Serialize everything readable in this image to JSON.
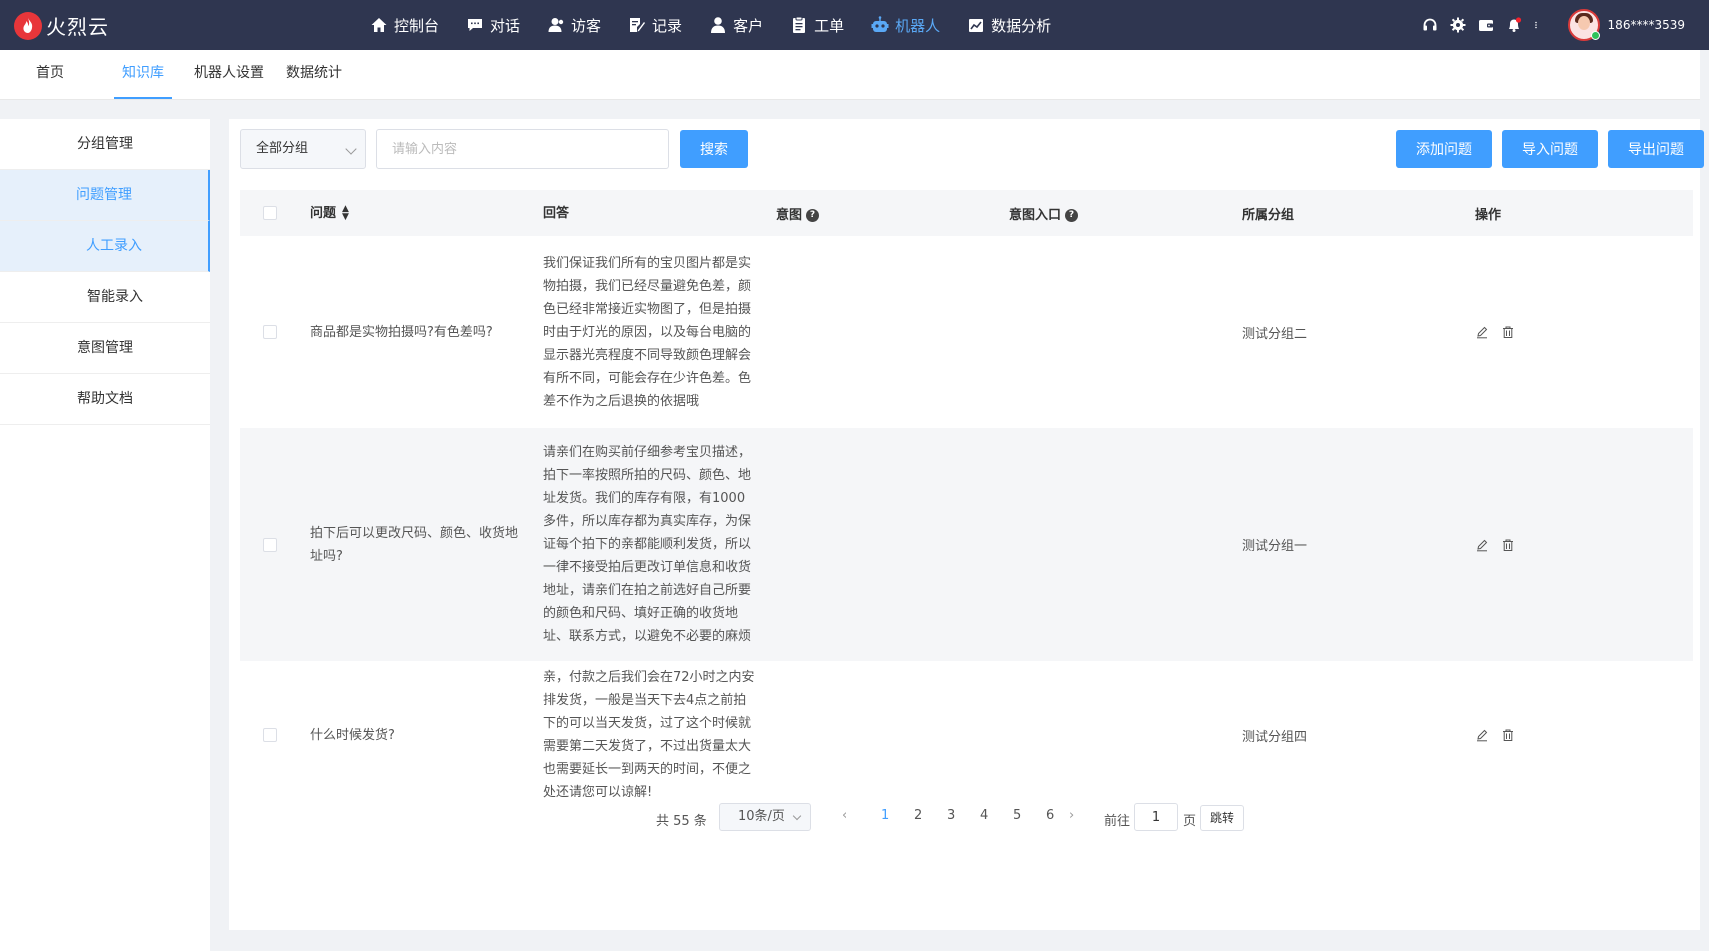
{
  "app": {
    "brand": "火烈云"
  },
  "mainnav": [
    {
      "label": "控制台",
      "icon": "home-icon"
    },
    {
      "label": "对话",
      "icon": "chat-icon"
    },
    {
      "label": "访客",
      "icon": "visitor-icon"
    },
    {
      "label": "记录",
      "icon": "record-icon"
    },
    {
      "label": "客户",
      "icon": "customer-icon"
    },
    {
      "label": "工单",
      "icon": "ticket-icon"
    },
    {
      "label": "机器人",
      "icon": "robot-icon",
      "active": true
    },
    {
      "label": "数据分析",
      "icon": "chart-icon"
    }
  ],
  "user": {
    "name": "186****3539"
  },
  "subnav": [
    {
      "label": "首页"
    },
    {
      "label": "知识库",
      "active": true
    },
    {
      "label": "机器人设置"
    },
    {
      "label": "数据统计"
    }
  ],
  "sidebar": [
    {
      "label": "分组管理"
    },
    {
      "label": "问题管理",
      "active": true
    },
    {
      "label": "人工录入",
      "active": true,
      "sub": true
    },
    {
      "label": "智能录入",
      "sub": true
    },
    {
      "label": "意图管理"
    },
    {
      "label": "帮助文档"
    }
  ],
  "toolbar": {
    "group_select": "全部分组",
    "search_placeholder": "请输入内容",
    "search_label": "搜索",
    "add_label": "添加问题",
    "import_label": "导入问题",
    "export_label": "导出问题"
  },
  "table": {
    "headers": {
      "question": "问题",
      "answer": "回答",
      "intent": "意图",
      "entry": "意图入口",
      "group": "所属分组",
      "op": "操作"
    },
    "rows": [
      {
        "question": "商品都是实物拍摄吗?有色差吗?",
        "answer": "我们保证我们所有的宝贝图片都是实物拍摄，我们已经尽量避免色差，颜色已经非常接近实物图了，但是拍摄时由于灯光的原因，以及每台电脑的显示器光亮程度不同导致颜色理解会有所不同，可能会存在少许色差。色差不作为之后退换的依据哦",
        "intent": "",
        "entry": "",
        "group": "测试分组二"
      },
      {
        "question": "拍下后可以更改尺码、颜色、收货地址吗?",
        "answer": "请亲们在购买前仔细参考宝贝描述，拍下一率按照所拍的尺码、颜色、地址发货。我们的库存有限，有1000多件，所以库存都为真实库存，为保证每个拍下的亲都能顺利发货，所以一律不接受拍后更改订单信息和收货地址，请亲们在拍之前选好自己所要的颜色和尺码、填好正确的收货地址、联系方式，以避免不必要的麻烦",
        "intent": "",
        "entry": "",
        "group": "测试分组一"
      },
      {
        "question": "什么时候发货?",
        "answer": "亲，付款之后我们会在72小时之内安排发货，一般是当天下去4点之前拍下的可以当天发货，过了这个时候就需要第二天发货了，不过出货量太大也需要延长一到两天的时间，不便之处还请您可以谅解!",
        "intent": "",
        "entry": "",
        "group": "测试分组四"
      }
    ]
  },
  "pagination": {
    "total": "共 55 条",
    "page_size": "10条/页",
    "pages": [
      "1",
      "2",
      "3",
      "4",
      "5",
      "6"
    ],
    "current": "1",
    "goto_label": "前往",
    "goto_value": "1",
    "goto_unit": "页",
    "goto_button": "跳转"
  },
  "colors": {
    "topbar": "#2f3650",
    "accent": "#409eff",
    "brand": "#e8363a"
  }
}
